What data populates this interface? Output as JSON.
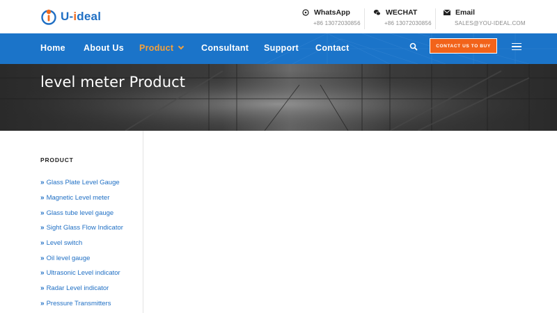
{
  "brand": {
    "logo_prefix": "U",
    "logo_dash": "-",
    "logo_i": "i",
    "logo_suffix": "deal"
  },
  "contacts": [
    {
      "icon": "whatsapp-icon",
      "title": "WhatsApp",
      "value": "+86 13072030856"
    },
    {
      "icon": "wechat-icon",
      "title": "WECHAT",
      "value": "+86 13072030856"
    },
    {
      "icon": "email-icon",
      "title": "Email",
      "value": "SALES@YOU-IDEAL.COM"
    }
  ],
  "nav": {
    "items": [
      "Home",
      "About Us",
      "Product",
      "Consultant",
      "Support",
      "Contact"
    ],
    "active": "Product",
    "cta_label": "CONTACT US TO BUY"
  },
  "hero": {
    "title": "level meter Product"
  },
  "sidebar": {
    "title": "PRODUCT",
    "items": [
      "Glass Plate Level Gauge",
      "Magnetic Level meter",
      "Glass tube level gauge",
      "Sight Glass Flow Indicator",
      "Level switch",
      "Oil level gauge",
      "Ultrasonic Level indicator",
      "Radar Level indicator",
      "Pressure Transmitters"
    ]
  },
  "colors": {
    "nav_bg": "#1b74c9",
    "accent": "#f2631a",
    "active_nav": "#f6a13a",
    "link": "#1f6fc4"
  }
}
